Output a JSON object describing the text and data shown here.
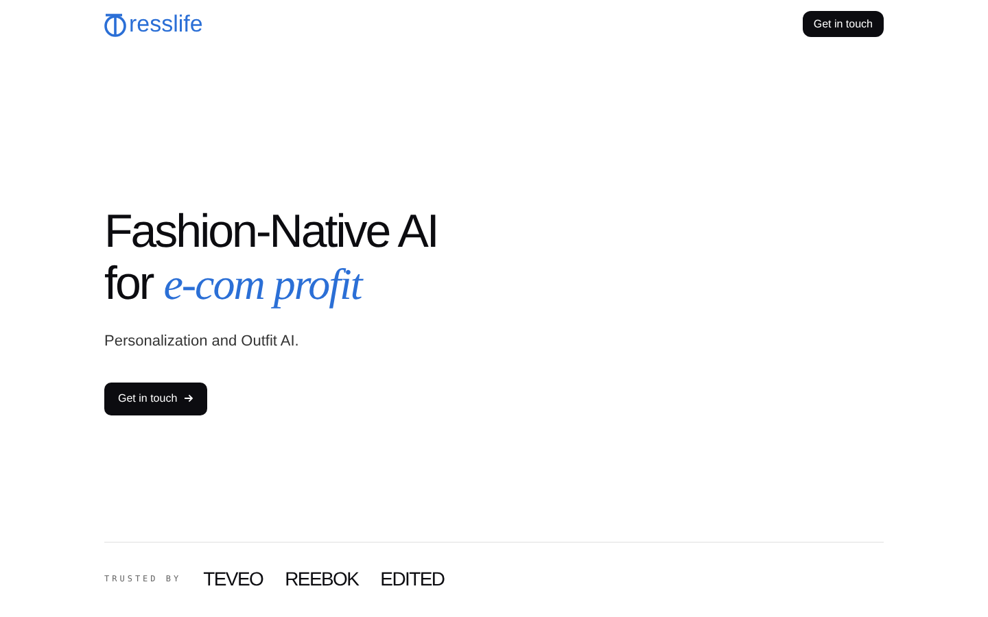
{
  "header": {
    "logo_text": "resslife",
    "button": "Get in touch"
  },
  "hero": {
    "title_line1": "Fashion-Native AI",
    "title_line2_lead": "for",
    "title_line2_accent": "e-com profit",
    "subtitle": "Personalization and Outfit AI.",
    "button": "Get in touch"
  },
  "trusted": {
    "label": "TRUSTED BY",
    "brands": [
      "TEVEO",
      "REEBOK",
      "EDITED"
    ]
  }
}
